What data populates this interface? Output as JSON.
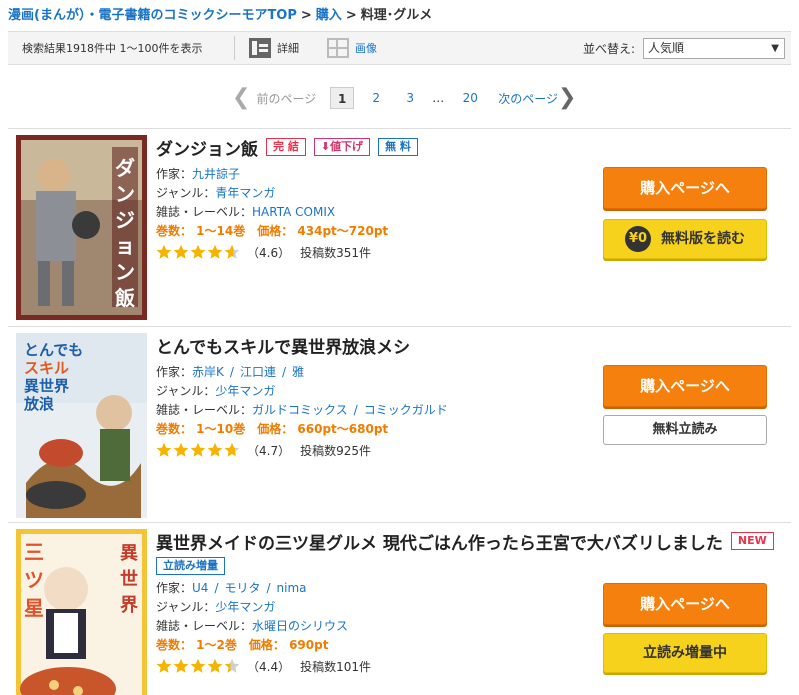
{
  "breadcrumb": {
    "home": "漫画(まんが）・電子書籍のコミックシーモアTOP",
    "sep": ">",
    "purchase": "購入",
    "current": "料理･グルメ"
  },
  "toolbar": {
    "result_count": "検索結果1918件中 1～100件を表示",
    "view_detail": "詳細",
    "view_image": "画像",
    "sort_label": "並べ替え:",
    "sort_value": "人気順",
    "sort_arrow": "▼"
  },
  "pager": {
    "prev": "前のページ",
    "pages": [
      "1",
      "2",
      "3"
    ],
    "ellipsis": "…",
    "last": "20",
    "next": "次のページ"
  },
  "colors": {
    "link": "#1a74c6",
    "buy": "#f5800d",
    "free": "#f7d21c",
    "price": "#f07c00",
    "star": "#f5b400"
  },
  "items": [
    {
      "title": "ダンジョン飯",
      "badges": [
        "完 結",
        "値下げ",
        "無 料"
      ],
      "author_label": "作家：",
      "authors": [
        "九井諒子"
      ],
      "genre_label": "ジャンル：",
      "genre": "青年マンガ",
      "label_label": "雑誌・レーベル：",
      "labels": [
        "HARTA COMIX"
      ],
      "volumes": "巻数：  1～14巻",
      "price": "価格：  434pt～720pt",
      "rating": 4.6,
      "score": "（4.6）",
      "posts": "投稿数351件",
      "buy": "購入ページへ",
      "free_button": "無料版を読む",
      "yen": "¥0"
    },
    {
      "title": "とんでもスキルで異世界放浪メシ",
      "author_label": "作家：",
      "authors": [
        "赤岸K",
        "江口連",
        "雅"
      ],
      "genre_label": "ジャンル：",
      "genre": "少年マンガ",
      "label_label": "雑誌・レーベル：",
      "labels": [
        "ガルドコミックス",
        "コミックガルド"
      ],
      "volumes": "巻数：  1～10巻",
      "price": "価格：  660pt～680pt",
      "rating": 4.7,
      "score": "（4.7）",
      "posts": "投稿数925件",
      "buy": "購入ページへ",
      "trial": "無料立読み"
    },
    {
      "title": "異世界メイドの三ツ星グルメ 現代ごはん作ったら王宮で大バズリしました",
      "new_badge": "NEW",
      "sub_badge": "立読み増量",
      "author_label": "作家：",
      "authors": [
        "U4",
        "モリタ",
        "nima"
      ],
      "genre_label": "ジャンル：",
      "genre": "少年マンガ",
      "label_label": "雑誌・レーベル：",
      "labels": [
        "水曜日のシリウス"
      ],
      "volumes": "巻数：  1～2巻",
      "price": "価格：  690pt",
      "rating": 4.4,
      "score": "（4.4）",
      "posts": "投稿数101件",
      "buy": "購入ページへ",
      "trial": "立読み増量中"
    }
  ]
}
